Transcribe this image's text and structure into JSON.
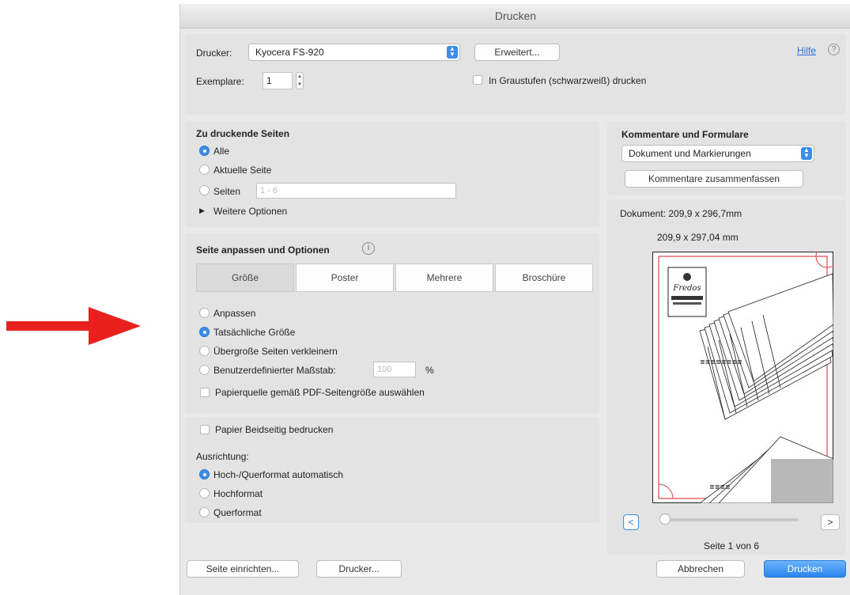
{
  "window": {
    "title": "Drucken"
  },
  "top": {
    "printer_label": "Drucker:",
    "printer_value": "Kyocera FS-920",
    "advanced_button": "Erweitert...",
    "help_link": "Hilfe",
    "help_icon": "?",
    "copies_label": "Exemplare:",
    "copies_value": "1",
    "grayscale_label": "In Graustufen (schwarzweiß) drucken"
  },
  "pages": {
    "heading": "Zu druckende Seiten",
    "all": "Alle",
    "current": "Aktuelle Seite",
    "pages": "Seiten",
    "pages_placeholder": "1 - 6",
    "more": "Weitere Optionen",
    "selected": "all"
  },
  "sizing": {
    "heading": "Seite anpassen und Optionen",
    "info_icon": "i",
    "tabs": [
      "Größe",
      "Poster",
      "Mehrere",
      "Broschüre"
    ],
    "active_tab": 0,
    "options": [
      "Anpassen",
      "Tatsächliche Größe",
      "Übergroße Seiten verkleinern",
      "Benutzerdefinierter Maßstab:"
    ],
    "selected_option": 1,
    "scale_value": "100",
    "scale_unit": "%",
    "paper_source": "Papierquelle gemäß PDF-Seitengröße auswählen"
  },
  "duplex": {
    "label": "Papier Beidseitig bedrucken",
    "orientation_label": "Ausrichtung:",
    "options": [
      "Hoch-/Querformat automatisch",
      "Hochformat",
      "Querformat"
    ],
    "selected": 0
  },
  "comments": {
    "heading": "Kommentare und Formulare",
    "select_value": "Dokument und Markierungen",
    "summarize_button": "Kommentare zusammenfassen"
  },
  "preview": {
    "doc_size": "Dokument: 209,9 x 296,7mm",
    "page_size": "209,9 x 297,04 mm",
    "prev": "<",
    "next": ">",
    "page_info": "Seite 1 von 6",
    "slider_fraction": 0.0
  },
  "footer": {
    "page_setup": "Seite einrichten...",
    "printer": "Drucker...",
    "cancel": "Abbrechen",
    "print": "Drucken"
  },
  "colors": {
    "accent": "#3b8de8",
    "arrow": "#e8201e",
    "preview_border": "#d9474a"
  }
}
